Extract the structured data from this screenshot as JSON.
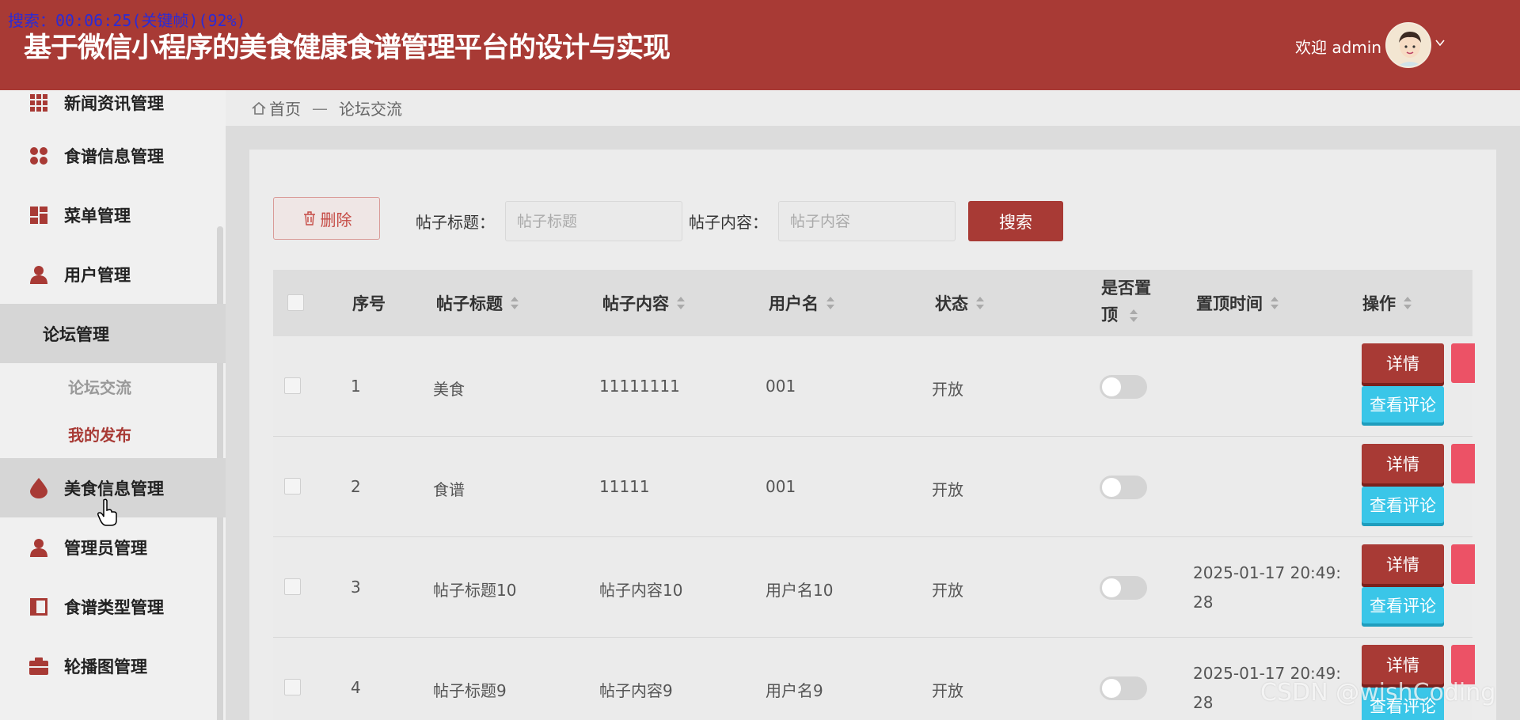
{
  "overlay": {
    "text": "搜索：00:06:25(关键帧)(92%)"
  },
  "header": {
    "title": "基于微信小程序的美食健康食谱管理平台的设计与实现",
    "welcome": "欢迎 admin",
    "brand_color": "#a83a35"
  },
  "sidebar": {
    "items": [
      {
        "label": "新闻资讯管理",
        "icon": "grid-icon"
      },
      {
        "label": "食谱信息管理",
        "icon": "dots-icon"
      },
      {
        "label": "菜单管理",
        "icon": "dashboard-icon"
      },
      {
        "label": "用户管理",
        "icon": "user-icon"
      },
      {
        "label": "论坛管理",
        "icon": ""
      },
      {
        "label": "美食信息管理",
        "icon": "drop-icon"
      },
      {
        "label": "管理员管理",
        "icon": "user-icon"
      },
      {
        "label": "食谱类型管理",
        "icon": "book-icon"
      },
      {
        "label": "轮播图管理",
        "icon": "briefcase-icon"
      }
    ],
    "forum_sub": [
      {
        "label": "论坛交流",
        "active": false
      },
      {
        "label": "我的发布",
        "active": true
      }
    ]
  },
  "breadcrumb": {
    "home": "首页",
    "separator": "—",
    "current": "论坛交流"
  },
  "filters": {
    "delete_label": "删除",
    "title_label": "帖子标题：",
    "title_placeholder": "帖子标题",
    "content_label": "帖子内容：",
    "content_placeholder": "帖子内容",
    "search_label": "搜索"
  },
  "table": {
    "columns": [
      "序号",
      "帖子标题",
      "帖子内容",
      "用户名",
      "状态",
      "是否置",
      "顶",
      "置顶时间",
      "操作"
    ],
    "rows": [
      {
        "index": "1",
        "title": "美食",
        "content": "11111111",
        "user": "001",
        "status": "开放",
        "pinned": false,
        "time_line1": "",
        "time_line2": ""
      },
      {
        "index": "2",
        "title": "食谱",
        "content": "11111",
        "user": "001",
        "status": "开放",
        "pinned": false,
        "time_line1": "",
        "time_line2": ""
      },
      {
        "index": "3",
        "title": "帖子标题10",
        "content": "帖子内容10",
        "user": "用户名10",
        "status": "开放",
        "pinned": false,
        "time_line1": "2025-01-17 20:49:",
        "time_line2": "28"
      },
      {
        "index": "4",
        "title": "帖子标题9",
        "content": "帖子内容9",
        "user": "用户名9",
        "status": "开放",
        "pinned": false,
        "time_line1": "2025-01-17 20:49:",
        "time_line2": "28"
      }
    ],
    "detail_label": "详情",
    "comment_label": "查看评论"
  },
  "watermark": "CSDN @wishCoding"
}
